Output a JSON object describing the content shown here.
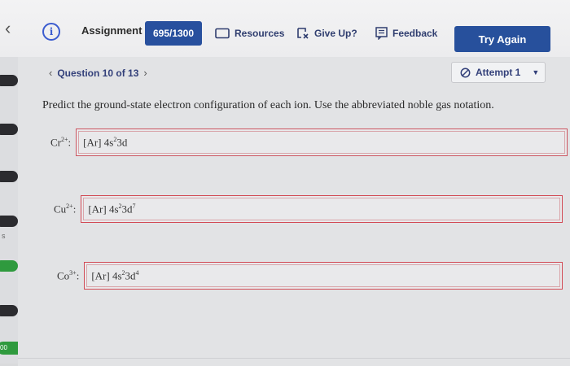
{
  "header": {
    "score_label": "Assignment Score:",
    "score_value": "695/1300",
    "resources_label": "Resources",
    "giveup_label": "Give Up?",
    "feedback_label": "Feedback",
    "try_again_label": "Try Again"
  },
  "question_nav": {
    "label": "Question 10 of 13"
  },
  "attempt": {
    "label": "Attempt 1"
  },
  "prompt": "Predict the ground-state electron configuration of each ion. Use the abbreviated noble gas notation.",
  "answers": [
    {
      "ion_symbol": "Cr",
      "ion_charge": "2+",
      "core": "[Ar] 4s",
      "s_exp": "2",
      "d_part": "3d",
      "d_exp": ""
    },
    {
      "ion_symbol": "Cu",
      "ion_charge": "2+",
      "core": "[Ar] 4s",
      "s_exp": "2",
      "d_part": "3d",
      "d_exp": "7"
    },
    {
      "ion_symbol": "Co",
      "ion_charge": "3+",
      "core": "[Ar] 4s",
      "s_exp": "2",
      "d_part": "3d",
      "d_exp": "4"
    }
  ],
  "left_rail": {
    "score_fragment": "00",
    "tick_fragment": "s"
  },
  "colors": {
    "primary_button": "#27509c",
    "answer_border_error": "#d24a55",
    "rail_green": "#2f9a3e"
  }
}
